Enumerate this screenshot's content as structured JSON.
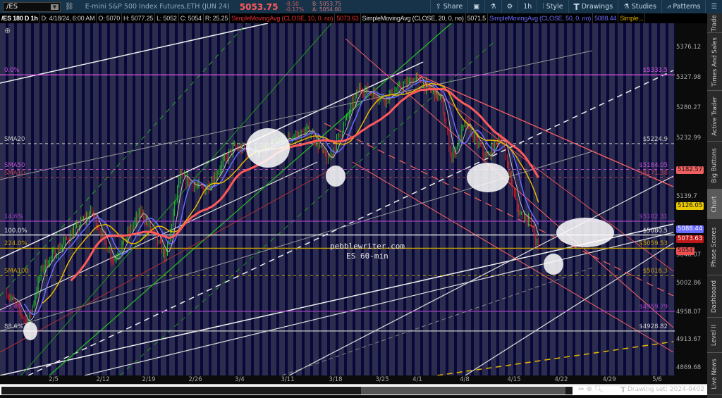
{
  "topbar": {
    "symbol": "/ES",
    "description": "E-mini S&P 500 Index Futures,ETH (JUN 24)",
    "last": "5053.75",
    "change": "-8.50",
    "change_pct": "-0.17%",
    "bid": "B: 5053.75",
    "ask": "A: 5054.00",
    "tools": [
      {
        "label": "Share",
        "icon": "share-icon"
      },
      {
        "label": "",
        "icon": "alert-icon"
      },
      {
        "label": "",
        "icon": "flask-icon"
      },
      {
        "label": "",
        "icon": "gear-icon"
      },
      {
        "label": "1h",
        "icon": ""
      },
      {
        "label": "Style",
        "icon": "style-icon"
      },
      {
        "label": "Drawings",
        "icon": "text-t-icon"
      },
      {
        "label": "Studies",
        "icon": "flask-icon"
      },
      {
        "label": "Patterns",
        "icon": "patterns-icon"
      },
      {
        "label": "",
        "icon": "menu-icon"
      }
    ]
  },
  "infobar": {
    "chart": "/ES 180 D 1h",
    "date": "D: 4/18/24, 6:00 AM",
    "open": "O: 5070",
    "high": "H: 5077.25",
    "low": "L: 5052",
    "close": "C: 5054",
    "range": "R: 25.25",
    "studies": [
      {
        "name": "SimpleMovingAvg (CLOSE, 10, 0, no)",
        "value": "5073.63",
        "color": "#e03030"
      },
      {
        "name": "SimpleMovingAvg (CLOSE, 20, 0, no)",
        "value": "5071.5",
        "color": "#dddddd"
      },
      {
        "name": "SimpleMovingAvg (CLOSE, 50, 0, no)",
        "value": "5088.44",
        "color": "#6a6aff"
      },
      {
        "name": "Simple...",
        "value": "",
        "color": "#d4a800"
      }
    ]
  },
  "levels": [
    {
      "label": "0.0%",
      "price_label": "$5333.5",
      "price": 5333.5,
      "color": "#d050e0",
      "style": "solid"
    },
    {
      "label": "SMA20",
      "price_label": "$5224.9",
      "price": 5224.9,
      "color": "#cccccc",
      "style": "dashed"
    },
    {
      "label": "SMA50",
      "price_label": "$5184.05",
      "price": 5184.05,
      "color": "#c050d0",
      "style": "dashed"
    },
    {
      "label": "SMA10",
      "price_label": "$5171.38",
      "price": 5171.38,
      "color": "#c04050",
      "style": "dashed"
    },
    {
      "label": "14.6%",
      "price_label": "$5102.31",
      "price": 5102.31,
      "color": "#a040c0",
      "style": "solid"
    },
    {
      "label": "100.0%",
      "price_label": "$5080.5",
      "price": 5080.5,
      "color": "#eeeeee",
      "style": "solid"
    },
    {
      "label": "224.0%",
      "price_label": "$5059.53",
      "price": 5059.53,
      "color": "#c8a000",
      "style": "solid"
    },
    {
      "label": "SMA100",
      "price_label": "$5016.3",
      "price": 5016.3,
      "color": "#c8a000",
      "style": "dashed"
    },
    {
      "label": "23.6%",
      "price_label": "$4959.79",
      "price": 4959.79,
      "color": "#a040c0",
      "style": "solid"
    },
    {
      "label": "88.6%",
      "price_label": "$4928.82",
      "price": 4928.82,
      "color": "#cccccc",
      "style": "solid"
    }
  ],
  "axis": {
    "ticks": [
      "5376.12",
      "5327.98",
      "5280.27",
      "5232.99",
      "5139.7",
      "5048.07",
      "5002.86",
      "4958.07",
      "4913.67",
      "4869.68"
    ],
    "badges": [
      {
        "value": "5182.57",
        "bg": "#f06060",
        "fg": "#111"
      },
      {
        "value": "5126.05",
        "bg": "#e8c800",
        "fg": "#111"
      },
      {
        "value": "5088.44",
        "bg": "#6a6aff",
        "fg": "#fff"
      },
      {
        "value": "5073.63",
        "bg": "#c01818",
        "fg": "#fff"
      },
      {
        "value": "5054",
        "bg": "#f05050",
        "fg": "#111"
      }
    ]
  },
  "dates": [
    "2/5",
    "2/12",
    "2/19",
    "2/26",
    "3/4",
    "3/11",
    "3/18",
    "3/25",
    "4/1",
    "4/8",
    "4/15",
    "4/22",
    "4/29",
    "5/6"
  ],
  "watermark": {
    "line1": "pebblewriter.com",
    "line2": "ES 60-min"
  },
  "bottom": {
    "drawing_set": "Drawing set: 2024-0402"
  },
  "side_tabs": [
    "Trade",
    "Times And Sales",
    "Active Trader",
    "Big Buttons",
    "Chart",
    "Phase Scores",
    "Dashboard",
    "Level II",
    "Live News"
  ],
  "chart_data": {
    "type": "candlestick",
    "x_unit": "days since 2/5/2024",
    "ylim": [
      4850,
      5400
    ],
    "key_prices": {
      "x": [
        -6.9,
        -3.8,
        -1.7,
        1.5,
        5.6,
        8.8,
        12.9,
        16.6,
        18.6,
        22.3,
        26.5,
        30.6,
        33.8,
        37.9,
        40.5,
        45.2,
        48.9,
        53.5,
        57.2,
        58.8,
        60.8,
        64,
        66,
        68.6,
        70.2,
        71.8
      ],
      "y": [
        4990,
        4940,
        5029,
        5068,
        5118,
        5040,
        5118,
        5045,
        5173,
        5151,
        5218,
        5212,
        5229,
        5246,
        5196,
        5313,
        5296,
        5329,
        5296,
        5201,
        5257,
        5201,
        5240,
        5118,
        5107,
        5054
      ]
    },
    "moving_averages": [
      {
        "name": "SMA10",
        "color": "#c0c0c0"
      },
      {
        "name": "SMA20",
        "color": "#6a6aff"
      },
      {
        "name": "SMA50",
        "color": "#e8b800"
      },
      {
        "name": "SMA100",
        "color": "#ff5a5a"
      }
    ]
  }
}
